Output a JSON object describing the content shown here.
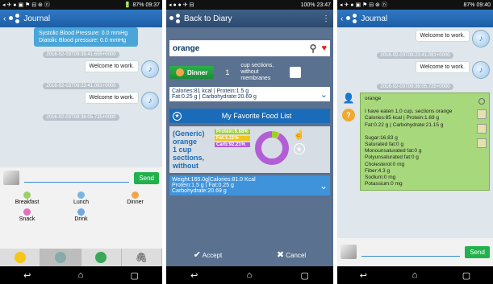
{
  "panel1": {
    "status": {
      "left": "◂ ✈ ● ▣ ⚑ ⊟ ⊛ ⓝ",
      "right": "🔋 87% 09:37"
    },
    "title": "Journal",
    "bp_lines": [
      "Systolic Blood Pressure: 0.0 mmHg",
      "Diatolic Blood pressure: 0.0 mmHg"
    ],
    "timestamps": [
      "2016-02-03T09:39:41.655+0000",
      "2016-02-03T09:23:41.091+0000",
      "2016-02-03T09:36:05.725+0000"
    ],
    "messages": [
      "Welcome to work.",
      "Welcome to work."
    ],
    "send_label": "Send",
    "meals": [
      {
        "label": "Breakfast",
        "color": "#9ccf6b"
      },
      {
        "label": "Lunch",
        "color": "#7bb5e3"
      },
      {
        "label": "Dinner",
        "color": "#f1a64d"
      },
      {
        "label": "Snack",
        "color": "#e56fbf"
      },
      {
        "label": "Drink",
        "color": "#6fa8e3"
      }
    ]
  },
  "panel2": {
    "status": {
      "left": "◂ ● ● ✈ ⊟",
      "right": "100% 23:47"
    },
    "back_label": "Back to Diary",
    "search_value": "orange",
    "meal_label": "Dinner",
    "quantity": "1",
    "unit": "cup sections, without membranes",
    "nutrition_line1": "Calories:81 kcal | Protein:1.5 g",
    "nutrition_line2": "Fat:0.25 g | Carbohydrate:20.69 g",
    "fav_title": "My Favorite Food List",
    "food_name_lines": [
      "(Generic)",
      "orange",
      "1 cup",
      "sections,",
      "without"
    ],
    "macros": [
      {
        "label": "Protein:6.68%",
        "color": "#9ccf2b",
        "pct": 6.68
      },
      {
        "label": "Fat:1.11%",
        "color": "#f0c51f",
        "pct": 1.11
      },
      {
        "label": "Carb:92.21%",
        "color": "#b25ed6",
        "pct": 92.21
      }
    ],
    "detail_line1": "Weight:165.0g|Calories:81.0 Kcal",
    "detail_line2": "Protein:1.5 g | Fat:0.25 g",
    "detail_line3": "Carbohydrate:20.69 g",
    "accept_label": "Accept",
    "cancel_label": "Cancel"
  },
  "panel3": {
    "status": {
      "left": "◂ ✈ ● ▣ ⚑ ⊟ ⊛ ⓝ",
      "right": "87% 09:40"
    },
    "title": "Journal",
    "messages": [
      "Welcome to work.",
      "Welcome to work."
    ],
    "timestamps": [
      "2016-02-03T09:23:41.091+0000",
      "2016-02-03T09:36:05.725+0000"
    ],
    "food_title": "orange",
    "food_lines": [
      "I have eaten 1.0 cup, sections orange",
      "Calories:85 kcal | Protein:1.69 g",
      "Fat:0.22 g | Carbohydrate:21.15 g",
      "",
      "Sugar:16.83 g",
      "Saturated fat:0 g",
      "Monounsaturated fat:0 g",
      "Polyunsaturated fat:0 g",
      "Cholesterol:0 mg",
      "Fiber:4.3 g",
      "Sodium:0 mg",
      "Potassium:0 mg"
    ],
    "send_label": "Send"
  }
}
